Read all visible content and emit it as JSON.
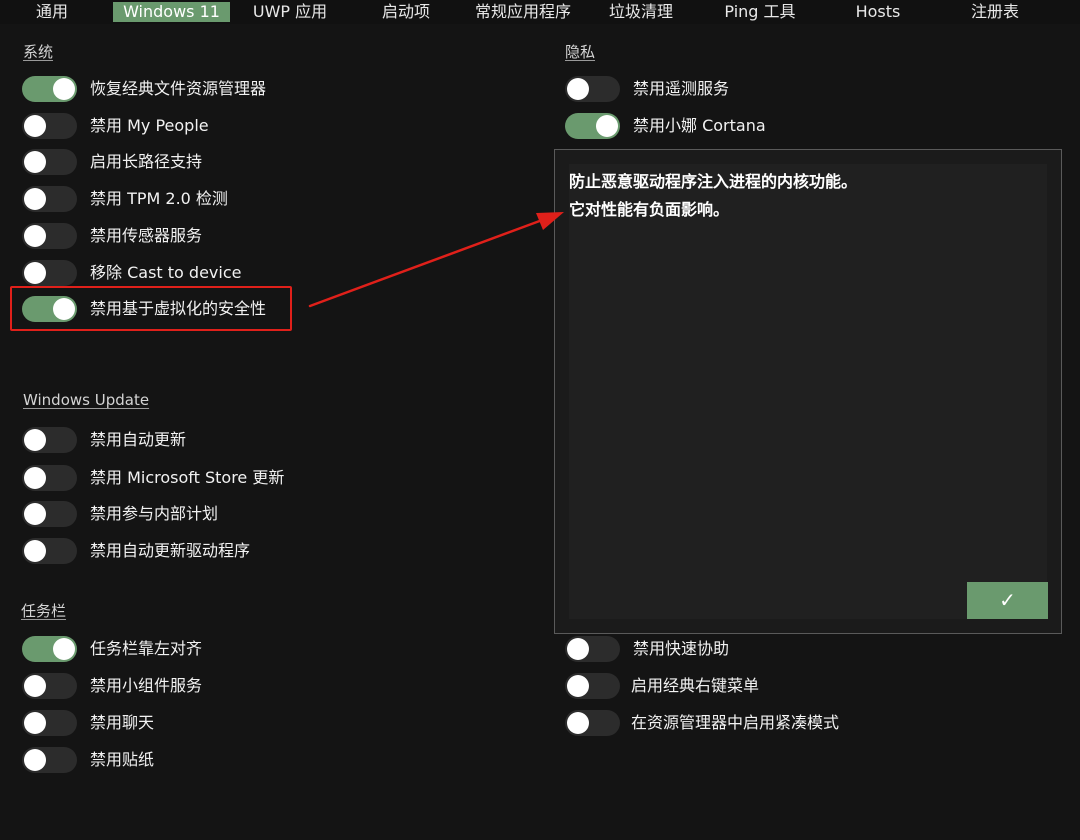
{
  "tabs": [
    {
      "label": "通用",
      "active": false
    },
    {
      "label": "Windows 11",
      "active": true
    },
    {
      "label": "UWP 应用",
      "active": false
    },
    {
      "label": "启动项",
      "active": false
    },
    {
      "label": "常规应用程序",
      "active": false
    },
    {
      "label": "垃圾清理",
      "active": false
    },
    {
      "label": "Ping 工具",
      "active": false
    },
    {
      "label": "Hosts",
      "active": false
    },
    {
      "label": "注册表",
      "active": false
    }
  ],
  "system": {
    "title": "系统",
    "items": [
      {
        "label": "恢复经典文件资源管理器",
        "on": true
      },
      {
        "label": "禁用 My People",
        "on": false
      },
      {
        "label": "启用长路径支持",
        "on": false
      },
      {
        "label": "禁用 TPM 2.0 检测",
        "on": false
      },
      {
        "label": "禁用传感器服务",
        "on": false
      },
      {
        "label": "移除 Cast to device",
        "on": false
      },
      {
        "label": "禁用基于虚拟化的安全性",
        "on": true
      }
    ]
  },
  "windows_update": {
    "title": "Windows Update",
    "items": [
      {
        "label": "禁用自动更新",
        "on": false
      },
      {
        "label": "禁用 Microsoft Store 更新",
        "on": false
      },
      {
        "label": "禁用参与内部计划",
        "on": false
      },
      {
        "label": "禁用自动更新驱动程序",
        "on": false
      }
    ]
  },
  "taskbar": {
    "title": "任务栏",
    "items": [
      {
        "label": "任务栏靠左对齐",
        "on": true
      },
      {
        "label": "禁用小组件服务",
        "on": false
      },
      {
        "label": "禁用聊天",
        "on": false
      },
      {
        "label": "禁用贴纸",
        "on": false
      }
    ]
  },
  "privacy": {
    "title": "隐私",
    "items": [
      {
        "label": "禁用遥测服务",
        "on": false
      },
      {
        "label": "禁用小娜 Cortana",
        "on": true
      }
    ]
  },
  "explorer": {
    "items": [
      {
        "label": "禁用快速协助",
        "on": false
      },
      {
        "label": "启用经典右键菜单",
        "on": false
      },
      {
        "label": "在资源管理器中启用紧凑模式",
        "on": false
      }
    ]
  },
  "popup": {
    "line1": "防止恶意驱动程序注入进程的内核功能。",
    "line2": "它对性能有负面影响。",
    "ok_label": "✓"
  },
  "colors": {
    "accent": "#6a9a6e",
    "background": "#141414",
    "annotation": "#e0201a"
  }
}
